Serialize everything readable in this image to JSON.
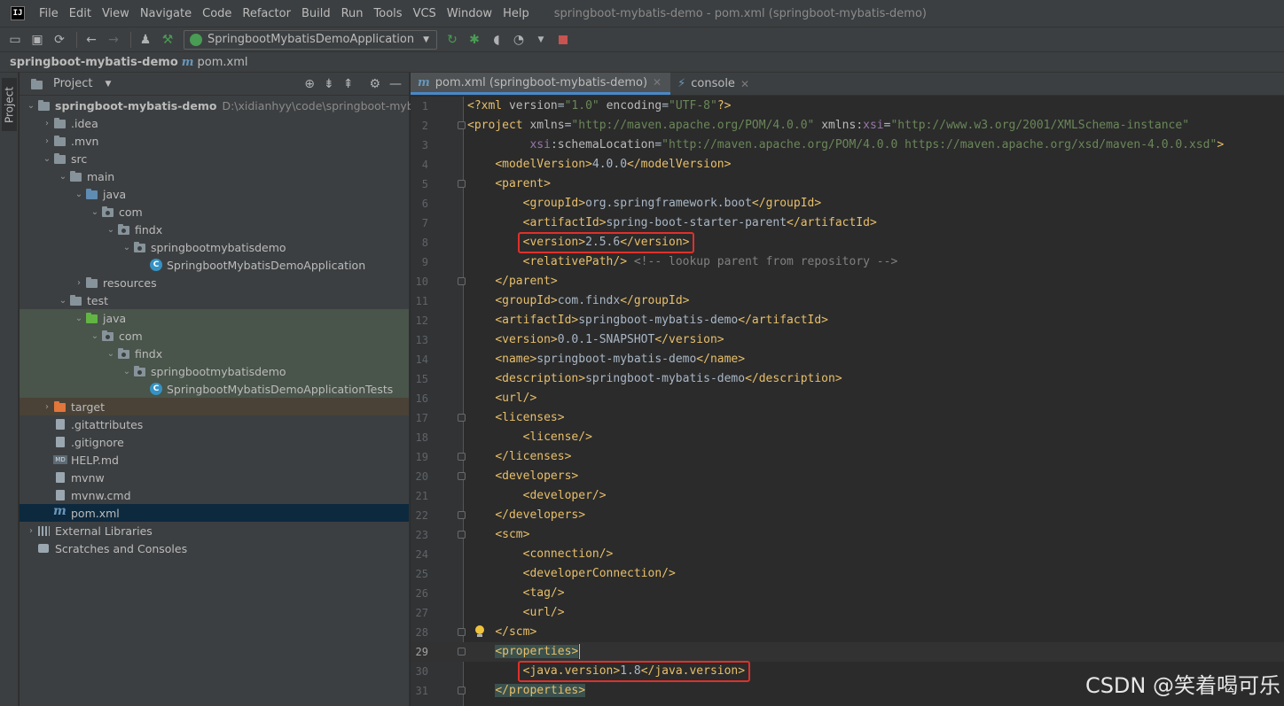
{
  "menubar": {
    "items": [
      "File",
      "Edit",
      "View",
      "Navigate",
      "Code",
      "Refactor",
      "Build",
      "Run",
      "Tools",
      "VCS",
      "Window",
      "Help"
    ],
    "window_title": "springboot-mybatis-demo - pom.xml (springboot-mybatis-demo)"
  },
  "toolbar": {
    "run_config": "SpringbootMybatisDemoApplication"
  },
  "navbar": {
    "project": "springboot-mybatis-demo",
    "file": "pom.xml"
  },
  "toolstrip": {
    "project_tab": "Project"
  },
  "project_panel": {
    "title": "Project",
    "tree": [
      {
        "depth": 0,
        "chev": "open",
        "icon": "module",
        "label": "springboot-mybatis-demo",
        "bold": true,
        "hint": "D:\\xidianhyy\\code\\springboot-mybatis-",
        "bg": ""
      },
      {
        "depth": 1,
        "chev": "closed",
        "icon": "folder",
        "label": ".idea",
        "bg": ""
      },
      {
        "depth": 1,
        "chev": "closed",
        "icon": "folder",
        "label": ".mvn",
        "bg": ""
      },
      {
        "depth": 1,
        "chev": "open",
        "icon": "folder",
        "label": "src",
        "bg": ""
      },
      {
        "depth": 2,
        "chev": "open",
        "icon": "folder",
        "label": "main",
        "bg": ""
      },
      {
        "depth": 3,
        "chev": "open",
        "icon": "folder-blue",
        "label": "java",
        "bg": ""
      },
      {
        "depth": 4,
        "chev": "open",
        "icon": "package",
        "label": "com",
        "bg": ""
      },
      {
        "depth": 5,
        "chev": "open",
        "icon": "package",
        "label": "findx",
        "bg": ""
      },
      {
        "depth": 6,
        "chev": "open",
        "icon": "package",
        "label": "springbootmybatisdemo",
        "bg": ""
      },
      {
        "depth": 7,
        "chev": "none",
        "icon": "class",
        "label": "SpringbootMybatisDemoApplication",
        "bg": ""
      },
      {
        "depth": 3,
        "chev": "closed",
        "icon": "folder",
        "label": "resources",
        "bg": ""
      },
      {
        "depth": 2,
        "chev": "open",
        "icon": "folder",
        "label": "test",
        "bg": ""
      },
      {
        "depth": 3,
        "chev": "open",
        "icon": "folder-green",
        "label": "java",
        "bg": "test"
      },
      {
        "depth": 4,
        "chev": "open",
        "icon": "package",
        "label": "com",
        "bg": "test"
      },
      {
        "depth": 5,
        "chev": "open",
        "icon": "package",
        "label": "findx",
        "bg": "test"
      },
      {
        "depth": 6,
        "chev": "open",
        "icon": "package",
        "label": "springbootmybatisdemo",
        "bg": "test"
      },
      {
        "depth": 7,
        "chev": "none",
        "icon": "class",
        "label": "SpringbootMybatisDemoApplicationTests",
        "bg": "test"
      },
      {
        "depth": 1,
        "chev": "closed",
        "icon": "folder-orange",
        "label": "target",
        "bg": "target"
      },
      {
        "depth": 1,
        "chev": "none",
        "icon": "file",
        "label": ".gitattributes",
        "bg": ""
      },
      {
        "depth": 1,
        "chev": "none",
        "icon": "file",
        "label": ".gitignore",
        "bg": ""
      },
      {
        "depth": 1,
        "chev": "none",
        "icon": "md",
        "label": "HELP.md",
        "bg": ""
      },
      {
        "depth": 1,
        "chev": "none",
        "icon": "file",
        "label": "mvnw",
        "bg": ""
      },
      {
        "depth": 1,
        "chev": "none",
        "icon": "file",
        "label": "mvnw.cmd",
        "bg": ""
      },
      {
        "depth": 1,
        "chev": "none",
        "icon": "maven",
        "label": "pom.xml",
        "bg": "selected"
      },
      {
        "depth": 0,
        "chev": "closed",
        "icon": "lib",
        "label": "External Libraries",
        "bg": ""
      },
      {
        "depth": 0,
        "chev": "none",
        "icon": "scratch",
        "label": "Scratches and Consoles",
        "bg": ""
      }
    ]
  },
  "editor": {
    "tabs": [
      {
        "label": "pom.xml (springboot-mybatis-demo)",
        "active": true,
        "icon": "maven"
      },
      {
        "label": "console",
        "active": false,
        "icon": "console"
      }
    ],
    "current_line": 29,
    "lines": [
      {
        "n": "1",
        "fold": false,
        "parts": [
          [
            "tag",
            "<?xml "
          ],
          [
            "attr",
            "version"
          ],
          [
            "text",
            "="
          ],
          [
            "val",
            "\"1.0\""
          ],
          [
            "text",
            " "
          ],
          [
            "attr",
            "encoding"
          ],
          [
            "text",
            "="
          ],
          [
            "val",
            "\"UTF-8\""
          ],
          [
            "tag",
            "?>"
          ]
        ]
      },
      {
        "n": "2",
        "fold": true,
        "parts": [
          [
            "tag",
            "<project "
          ],
          [
            "attr",
            "xmlns"
          ],
          [
            "text",
            "="
          ],
          [
            "val",
            "\"http://maven.apache.org/POM/4.0.0\""
          ],
          [
            "text",
            " "
          ],
          [
            "attr",
            "xmlns"
          ],
          [
            "text",
            ":"
          ],
          [
            "ns",
            "xsi"
          ],
          [
            "text",
            "="
          ],
          [
            "val",
            "\"http://www.w3.org/2001/XMLSchema-instance\""
          ]
        ]
      },
      {
        "n": "3",
        "fold": false,
        "parts": [
          [
            "text",
            "         "
          ],
          [
            "ns",
            "xsi"
          ],
          [
            "text",
            ":"
          ],
          [
            "attr",
            "schemaLocation"
          ],
          [
            "text",
            "="
          ],
          [
            "val",
            "\"http://maven.apache.org/POM/4.0.0 https://maven.apache.org/xsd/maven-4.0.0.xsd\""
          ],
          [
            "tag",
            ">"
          ]
        ]
      },
      {
        "n": "4",
        "fold": false,
        "parts": [
          [
            "text",
            "    "
          ],
          [
            "tag",
            "<modelVersion>"
          ],
          [
            "text",
            "4.0.0"
          ],
          [
            "tag",
            "</modelVersion>"
          ]
        ]
      },
      {
        "n": "5",
        "fold": true,
        "parts": [
          [
            "text",
            "    "
          ],
          [
            "tag",
            "<parent>"
          ]
        ]
      },
      {
        "n": "6",
        "fold": false,
        "parts": [
          [
            "text",
            "        "
          ],
          [
            "tag",
            "<groupId>"
          ],
          [
            "text",
            "org.springframework.boot"
          ],
          [
            "tag",
            "</groupId>"
          ]
        ]
      },
      {
        "n": "7",
        "fold": false,
        "parts": [
          [
            "text",
            "        "
          ],
          [
            "tag",
            "<artifactId>"
          ],
          [
            "text",
            "spring-boot-starter-parent"
          ],
          [
            "tag",
            "</artifactId>"
          ]
        ]
      },
      {
        "n": "8",
        "fold": false,
        "parts": [
          [
            "text",
            "        "
          ],
          [
            "tag",
            "<version>"
          ],
          [
            "text",
            "2.5.6"
          ],
          [
            "tag",
            "</version>"
          ]
        ]
      },
      {
        "n": "9",
        "fold": false,
        "parts": [
          [
            "text",
            "        "
          ],
          [
            "tag",
            "<relativePath/>"
          ],
          [
            "text",
            " "
          ],
          [
            "com",
            "<!-- lookup parent from repository -->"
          ]
        ]
      },
      {
        "n": "10",
        "fold": true,
        "parts": [
          [
            "text",
            "    "
          ],
          [
            "tag",
            "</parent>"
          ]
        ]
      },
      {
        "n": "11",
        "fold": false,
        "parts": [
          [
            "text",
            "    "
          ],
          [
            "tag",
            "<groupId>"
          ],
          [
            "text",
            "com.findx"
          ],
          [
            "tag",
            "</groupId>"
          ]
        ]
      },
      {
        "n": "12",
        "fold": false,
        "parts": [
          [
            "text",
            "    "
          ],
          [
            "tag",
            "<artifactId>"
          ],
          [
            "text",
            "springboot-mybatis-demo"
          ],
          [
            "tag",
            "</artifactId>"
          ]
        ]
      },
      {
        "n": "13",
        "fold": false,
        "parts": [
          [
            "text",
            "    "
          ],
          [
            "tag",
            "<version>"
          ],
          [
            "text",
            "0.0.1-SNAPSHOT"
          ],
          [
            "tag",
            "</version>"
          ]
        ]
      },
      {
        "n": "14",
        "fold": false,
        "parts": [
          [
            "text",
            "    "
          ],
          [
            "tag",
            "<name>"
          ],
          [
            "text",
            "springboot-mybatis-demo"
          ],
          [
            "tag",
            "</name>"
          ]
        ]
      },
      {
        "n": "15",
        "fold": false,
        "parts": [
          [
            "text",
            "    "
          ],
          [
            "tag",
            "<description>"
          ],
          [
            "text",
            "springboot-mybatis-demo"
          ],
          [
            "tag",
            "</description>"
          ]
        ]
      },
      {
        "n": "16",
        "fold": false,
        "parts": [
          [
            "text",
            "    "
          ],
          [
            "tag",
            "<url/>"
          ]
        ]
      },
      {
        "n": "17",
        "fold": true,
        "parts": [
          [
            "text",
            "    "
          ],
          [
            "tag",
            "<licenses>"
          ]
        ]
      },
      {
        "n": "18",
        "fold": false,
        "parts": [
          [
            "text",
            "        "
          ],
          [
            "tag",
            "<license/>"
          ]
        ]
      },
      {
        "n": "19",
        "fold": true,
        "parts": [
          [
            "text",
            "    "
          ],
          [
            "tag",
            "</licenses>"
          ]
        ]
      },
      {
        "n": "20",
        "fold": true,
        "parts": [
          [
            "text",
            "    "
          ],
          [
            "tag",
            "<developers>"
          ]
        ]
      },
      {
        "n": "21",
        "fold": false,
        "parts": [
          [
            "text",
            "        "
          ],
          [
            "tag",
            "<developer/>"
          ]
        ]
      },
      {
        "n": "22",
        "fold": true,
        "parts": [
          [
            "text",
            "    "
          ],
          [
            "tag",
            "</developers>"
          ]
        ]
      },
      {
        "n": "23",
        "fold": true,
        "parts": [
          [
            "text",
            "    "
          ],
          [
            "tag",
            "<scm>"
          ]
        ]
      },
      {
        "n": "24",
        "fold": false,
        "parts": [
          [
            "text",
            "        "
          ],
          [
            "tag",
            "<connection/>"
          ]
        ]
      },
      {
        "n": "25",
        "fold": false,
        "parts": [
          [
            "text",
            "        "
          ],
          [
            "tag",
            "<developerConnection/>"
          ]
        ]
      },
      {
        "n": "26",
        "fold": false,
        "parts": [
          [
            "text",
            "        "
          ],
          [
            "tag",
            "<tag/>"
          ]
        ]
      },
      {
        "n": "27",
        "fold": false,
        "parts": [
          [
            "text",
            "        "
          ],
          [
            "tag",
            "<url/>"
          ]
        ]
      },
      {
        "n": "28",
        "fold": true,
        "parts": [
          [
            "text",
            "    "
          ],
          [
            "tag",
            "</scm>"
          ]
        ]
      },
      {
        "n": "29",
        "fold": true,
        "parts": [
          [
            "text",
            "    "
          ],
          [
            "taghl",
            "<properties>"
          ]
        ]
      },
      {
        "n": "30",
        "fold": false,
        "parts": [
          [
            "text",
            "        "
          ],
          [
            "tag",
            "<java.version>"
          ],
          [
            "text",
            "1.8"
          ],
          [
            "tag",
            "</java.version>"
          ]
        ]
      },
      {
        "n": "31",
        "fold": true,
        "parts": [
          [
            "text",
            "    "
          ],
          [
            "taghl",
            "</properties>"
          ]
        ]
      }
    ]
  },
  "watermark": "CSDN @笑着喝可乐",
  "colors": {
    "tag": "#e8bf6a",
    "attr": "#bababa",
    "ns": "#9876aa",
    "value": "#6a8759",
    "text": "#a9b7c6",
    "comment": "#808080",
    "highlight_box": "#e0302b",
    "selection": "#0d293e"
  }
}
